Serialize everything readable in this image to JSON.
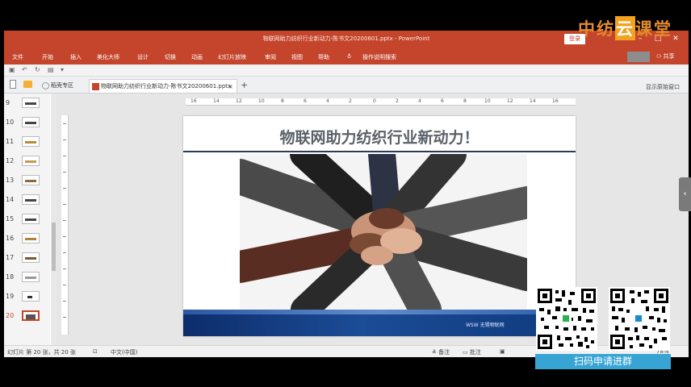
{
  "window": {
    "title": "物联网助力纺织行业新动力-陈书文20200601.pptx - PowerPoint",
    "login_label": "登录"
  },
  "ribbon": {
    "tabs": [
      "文件",
      "开始",
      "插入",
      "美化大师",
      "设计",
      "切换",
      "动画",
      "幻灯片放映",
      "审阅",
      "视图",
      "帮助"
    ],
    "tell_me": "操作说明搜索",
    "share": "共享"
  },
  "doc_tabs": {
    "tab1": "稻壳专区",
    "tab2": "物联网助力纺织行业新动力-陈书文20200601.pptx",
    "new_window": "显示原始窗口"
  },
  "thumbnails": [
    {
      "num": "9"
    },
    {
      "num": "10"
    },
    {
      "num": "11"
    },
    {
      "num": "12"
    },
    {
      "num": "13"
    },
    {
      "num": "14"
    },
    {
      "num": "15"
    },
    {
      "num": "16"
    },
    {
      "num": "17"
    },
    {
      "num": "18"
    },
    {
      "num": "19"
    },
    {
      "num": "20"
    }
  ],
  "active_slide": "20",
  "ruler_labels": [
    "16",
    "14",
    "12",
    "10",
    "8",
    "6",
    "4",
    "2",
    "0",
    "2",
    "4",
    "6",
    "8",
    "10",
    "12",
    "14",
    "16"
  ],
  "slide": {
    "title": "物联网助力纺织行业新动力！",
    "footer_logo": "WSW 无锡物联网"
  },
  "status": {
    "slide_count": "幻灯片 第 20 张，共 20 张",
    "language": "中文(中国)",
    "notes": "备注",
    "comments": "批注",
    "zoom": "78%"
  },
  "watermark": {
    "part1": "中纺",
    "part2": "云",
    "part3": "课堂"
  },
  "qr_label": "扫码申请进群",
  "colors": {
    "accent": "#c4452c",
    "qr_label_bg": "#38a4d4",
    "watermark": "#e38b2e"
  }
}
